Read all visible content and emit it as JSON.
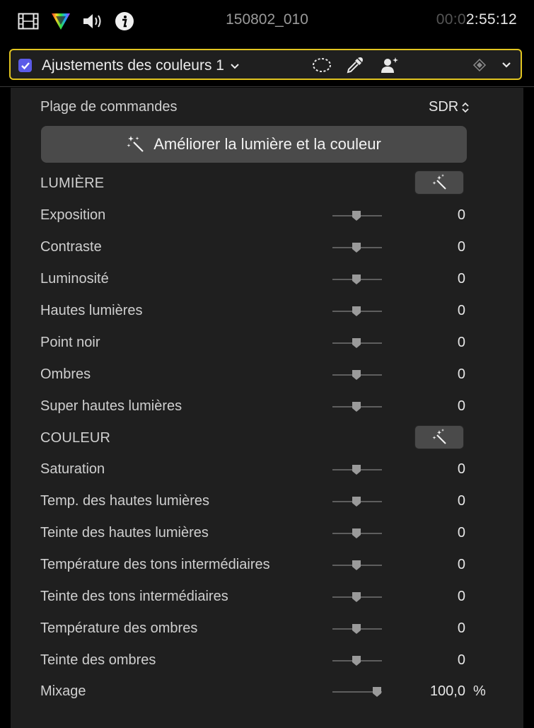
{
  "topbar": {
    "icons": [
      "film-icon",
      "color-wheel-icon",
      "speaker-icon",
      "info-icon"
    ],
    "clip_name": "150802_010",
    "timecode_dim": "00:0",
    "timecode_bright": "2:55:12"
  },
  "effect": {
    "enabled": true,
    "title": "Ajustements des couleurs 1",
    "header_icons": [
      "mask-circle-icon",
      "eyedropper-icon",
      "person-mask-icon",
      "keyframe-diamond-icon",
      "chevron-down-icon"
    ],
    "accent_color": "#e2c520",
    "checkbox_color": "#5b5be8"
  },
  "controls": {
    "range_label": "Plage de commandes",
    "range_value": "SDR",
    "enhance_button": "Améliorer la lumière et la couleur"
  },
  "sections": {
    "light": "LUMIÈRE",
    "color": "COULEUR"
  },
  "light_params": [
    {
      "label": "Exposition",
      "value": "0"
    },
    {
      "label": "Contraste",
      "value": "0"
    },
    {
      "label": "Luminosité",
      "value": "0"
    },
    {
      "label": "Hautes lumières",
      "value": "0"
    },
    {
      "label": "Point noir",
      "value": "0"
    },
    {
      "label": "Ombres",
      "value": "0"
    },
    {
      "label": "Super hautes lumières",
      "value": "0"
    }
  ],
  "color_params": [
    {
      "label": "Saturation",
      "value": "0"
    },
    {
      "label": "Temp. des hautes lumières",
      "value": "0"
    },
    {
      "label": "Teinte des hautes lumières",
      "value": "0"
    },
    {
      "label": "Température des tons intermédiaires",
      "value": "0"
    },
    {
      "label": "Teinte des tons intermédiaires",
      "value": "0"
    },
    {
      "label": "Température des ombres",
      "value": "0"
    },
    {
      "label": "Teinte des ombres",
      "value": "0"
    }
  ],
  "mix": {
    "label": "Mixage",
    "value": "100,0",
    "unit": "%",
    "level": 1.0
  }
}
